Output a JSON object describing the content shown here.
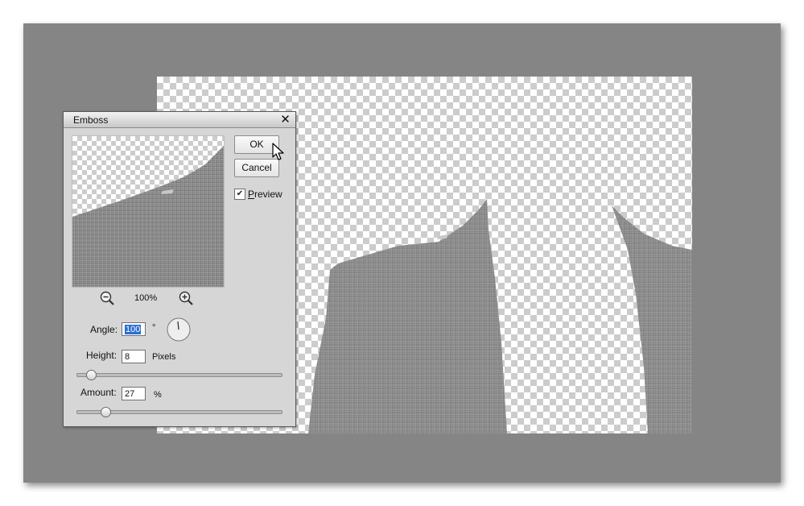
{
  "dialog": {
    "title": "Emboss",
    "ok_label": "OK",
    "cancel_label": "Cancel",
    "preview_checkbox": {
      "label_first": "P",
      "label_rest": "review",
      "checked": true
    },
    "zoom_level": "100%",
    "angle": {
      "label": "Angle:",
      "value": "100",
      "unit": "°"
    },
    "height": {
      "label": "Height:",
      "value": "8",
      "unit": "Pixels",
      "slider_fraction": 0.07
    },
    "amount": {
      "label": "Amount:",
      "value": "27",
      "unit": "%",
      "slider_fraction": 0.14
    }
  },
  "icons": {
    "close": "close-icon",
    "zoom_out": "zoom-out-icon",
    "zoom_in": "zoom-in-icon",
    "cursor": "mouse-pointer-icon"
  },
  "colors": {
    "workspace": "#858585",
    "selection": "#2a6fd3",
    "fabric": "#8a8a8a"
  }
}
